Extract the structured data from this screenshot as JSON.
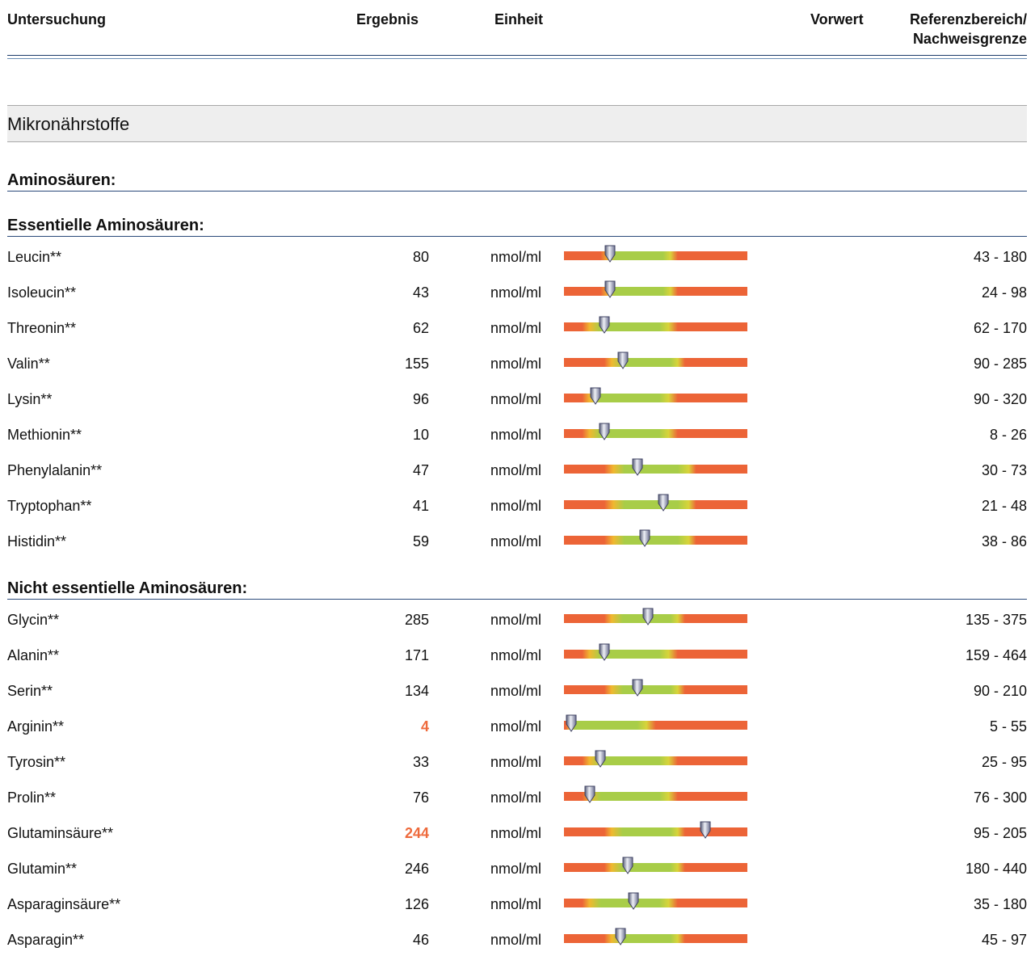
{
  "header": {
    "col_test": "Untersuchung",
    "col_result": "Ergebnis",
    "col_unit": "Einheit",
    "col_prev": "Vorwert",
    "col_ref_line1": "Referenzbereich/",
    "col_ref_line2": "Nachweisgrenze"
  },
  "section": {
    "title": "Mikronährstoffe"
  },
  "groups": {
    "aminos": "Aminosäuren:",
    "essential": "Essentielle Aminosäuren:",
    "nonessential": "Nicht essentielle Aminosäuren:"
  },
  "essential_rows": [
    {
      "name": "Leucin**",
      "value": "80",
      "unit": "nmol/ml",
      "ref": "43 - 180",
      "marker_pos": 0.25
    },
    {
      "name": "Isoleucin**",
      "value": "43",
      "unit": "nmol/ml",
      "ref": "24 - 98",
      "marker_pos": 0.25
    },
    {
      "name": "Threonin**",
      "value": "62",
      "unit": "nmol/ml",
      "ref": "62 - 170",
      "marker_pos": 0.22
    },
    {
      "name": "Valin**",
      "value": "155",
      "unit": "nmol/ml",
      "ref": "90 - 285",
      "marker_pos": 0.32
    },
    {
      "name": "Lysin**",
      "value": "96",
      "unit": "nmol/ml",
      "ref": "90 - 320",
      "marker_pos": 0.17
    },
    {
      "name": "Methionin**",
      "value": "10",
      "unit": "nmol/ml",
      "ref": "8 - 26",
      "marker_pos": 0.22
    },
    {
      "name": "Phenylalanin**",
      "value": "47",
      "unit": "nmol/ml",
      "ref": "30 - 73",
      "marker_pos": 0.4
    },
    {
      "name": "Tryptophan**",
      "value": "41",
      "unit": "nmol/ml",
      "ref": "21 - 48",
      "marker_pos": 0.54
    },
    {
      "name": "Histidin**",
      "value": "59",
      "unit": "nmol/ml",
      "ref": "38 - 86",
      "marker_pos": 0.44
    }
  ],
  "nonessential_rows": [
    {
      "name": "Glycin**",
      "value": "285",
      "unit": "nmol/ml",
      "ref": "135 - 375",
      "marker_pos": 0.46
    },
    {
      "name": "Alanin**",
      "value": "171",
      "unit": "nmol/ml",
      "ref": "159 - 464",
      "marker_pos": 0.22
    },
    {
      "name": "Serin**",
      "value": "134",
      "unit": "nmol/ml",
      "ref": "90 - 210",
      "marker_pos": 0.4
    },
    {
      "name": "Arginin**",
      "value": "4",
      "unit": "nmol/ml",
      "ref": "5 - 55",
      "marker_pos": 0.04,
      "flag": true
    },
    {
      "name": "Tyrosin**",
      "value": "33",
      "unit": "nmol/ml",
      "ref": "25 - 95",
      "marker_pos": 0.2
    },
    {
      "name": "Prolin**",
      "value": "76",
      "unit": "nmol/ml",
      "ref": "76 - 300",
      "marker_pos": 0.14
    },
    {
      "name": "Glutaminsäure**",
      "value": "244",
      "unit": "nmol/ml",
      "ref": "95 - 205",
      "marker_pos": 0.77,
      "flag": true
    },
    {
      "name": "Glutamin**",
      "value": "246",
      "unit": "nmol/ml",
      "ref": "180 - 440",
      "marker_pos": 0.35
    },
    {
      "name": "Asparaginsäure**",
      "value": "126",
      "unit": "nmol/ml",
      "ref": "35 - 180",
      "marker_pos": 0.38
    },
    {
      "name": "Asparagin**",
      "value": "46",
      "unit": "nmol/ml",
      "ref": "45 - 97",
      "marker_pos": 0.31
    }
  ]
}
